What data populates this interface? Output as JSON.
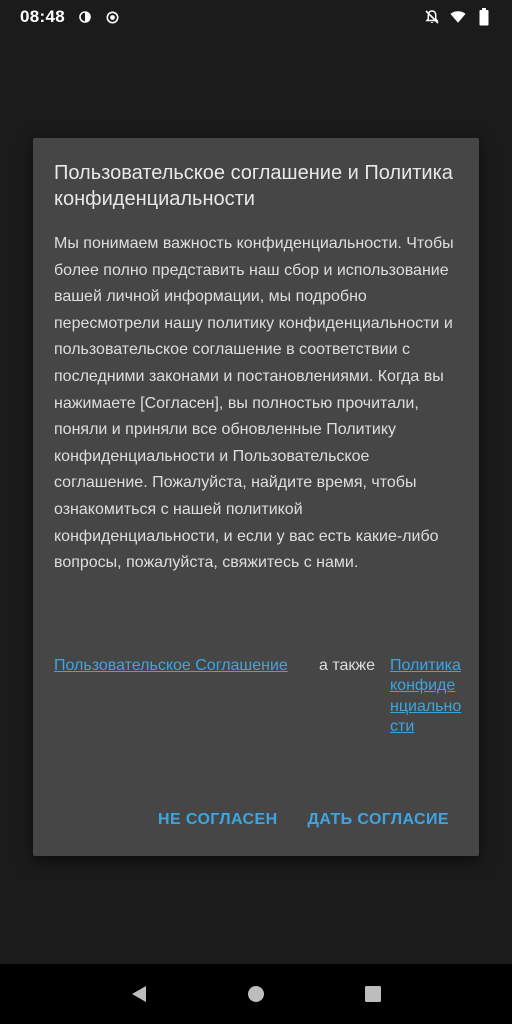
{
  "status_bar": {
    "time": "08:48",
    "icons": [
      "data-saver-icon",
      "record-icon",
      "notifications-off-icon",
      "wifi-icon",
      "battery-icon"
    ]
  },
  "dialog": {
    "title": "Пользовательское соглашение и Политика конфиденциальности",
    "body": "Мы понимаем важность конфиденциальности. Чтобы более полно представить наш сбор и использование вашей личной информации, мы подробно пересмотрели нашу политику конфиденциальности и пользовательское соглашение в соответствии с последними законами и постановлениями. Когда вы нажимаете [Согласен], вы полностью прочитали, поняли и приняли все обновленные Политику конфиденциальности и Пользовательское соглашение. Пожалуйста, найдите время, чтобы ознакомиться с нашей политикой конфиденциальности, и если у вас есть какие-либо вопросы, пожалуйста, свяжитесь с нами.",
    "link_agreement": "Пользовательское Соглашение",
    "links_and": "а также",
    "link_privacy": "Политика конфиденциальности",
    "disagree_label": "НЕ СОГЛАСЕН",
    "agree_label": "ДАТЬ СОГЛАСИЕ"
  },
  "nav_bar": {
    "icons": [
      "back-icon",
      "home-icon",
      "recents-icon"
    ]
  },
  "colors": {
    "background": "#1b1b1b",
    "dialog": "#464646",
    "accent": "#3fa5e0",
    "text": "#dedede"
  }
}
